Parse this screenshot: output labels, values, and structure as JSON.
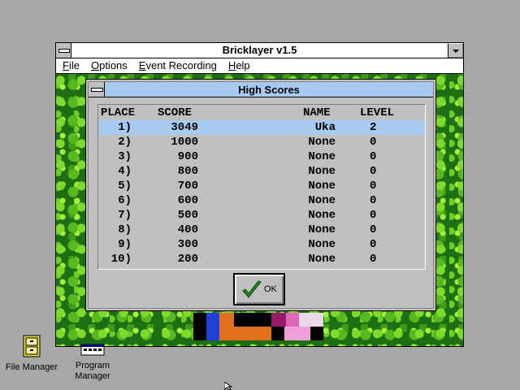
{
  "window": {
    "title": "Bricklayer v1.5",
    "menu": [
      {
        "label": "File",
        "mnemonic": "F"
      },
      {
        "label": "Options",
        "mnemonic": "O"
      },
      {
        "label": "Event Recording",
        "mnemonic": "E"
      },
      {
        "label": "Help",
        "mnemonic": "H"
      }
    ]
  },
  "dialog": {
    "title": "High Scores",
    "headers": {
      "place": "PLACE",
      "score": "SCORE",
      "name": "NAME",
      "level": "LEVEL"
    },
    "rows": [
      {
        "place": "1)",
        "score": "3049",
        "name": "Uka",
        "level": "2"
      },
      {
        "place": "2)",
        "score": "1000",
        "name": "None",
        "level": "0"
      },
      {
        "place": "3)",
        "score": "900",
        "name": "None",
        "level": "0"
      },
      {
        "place": "4)",
        "score": "800",
        "name": "None",
        "level": "0"
      },
      {
        "place": "5)",
        "score": "700",
        "name": "None",
        "level": "0"
      },
      {
        "place": "6)",
        "score": "600",
        "name": "None",
        "level": "0"
      },
      {
        "place": "7)",
        "score": "500",
        "name": "None",
        "level": "0"
      },
      {
        "place": "8)",
        "score": "400",
        "name": "None",
        "level": "0"
      },
      {
        "place": "9)",
        "score": "300",
        "name": "None",
        "level": "0"
      },
      {
        "place": "10)",
        "score": "200",
        "name": "None",
        "level": "0"
      }
    ],
    "selected_row": 0,
    "ok_label": "OK",
    "ok_icon": "checkmark-icon"
  },
  "desktop": {
    "icons": [
      {
        "label": "File Manager",
        "icon": "file-cabinet-icon"
      },
      {
        "label": "Program Manager",
        "icon": "program-manager-icon"
      }
    ]
  },
  "colors": {
    "desktop": "#a8a8a8",
    "selection": "#a6caf0",
    "dialog_face": "#c0c0c0",
    "checkmark": "#1a8a1a"
  }
}
